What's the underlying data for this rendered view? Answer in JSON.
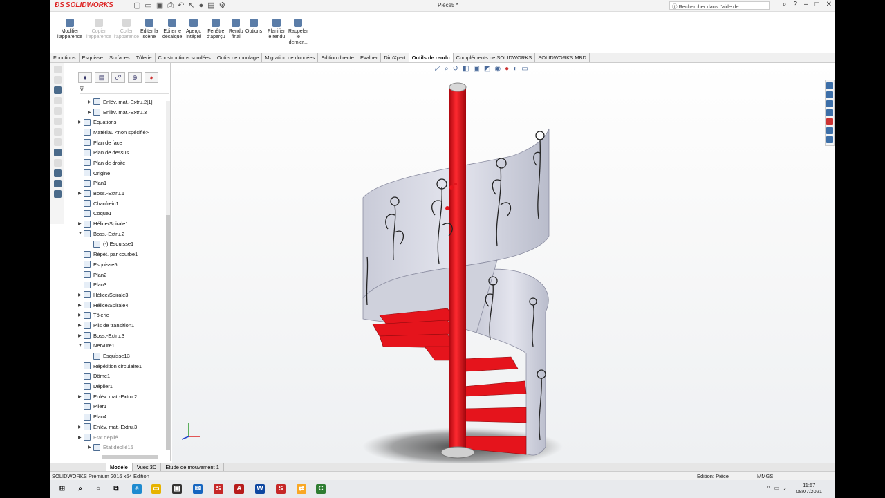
{
  "app": {
    "brand": "SOLIDWORKS",
    "document_title": "Pièce5 *",
    "search_placeholder": "Rechercher dans l'aide de SOLIDWORKS"
  },
  "ribbon": [
    {
      "label1": "Modifier",
      "label2": "l'apparence",
      "enabled": true
    },
    {
      "label1": "Copier",
      "label2": "l'apparence",
      "enabled": false
    },
    {
      "label1": "Coller",
      "label2": "l'apparence",
      "enabled": false
    },
    {
      "label1": "Editer la",
      "label2": "scène",
      "enabled": true
    },
    {
      "label1": "Editer le",
      "label2": "décalque",
      "enabled": true
    },
    {
      "label1": "Aperçu",
      "label2": "intégré",
      "enabled": true
    },
    {
      "label1": "Fenêtre",
      "label2": "d'aperçu",
      "enabled": true
    },
    {
      "label1": "Rendu",
      "label2": "final",
      "enabled": true
    },
    {
      "label1": "Options",
      "label2": "",
      "enabled": true
    },
    {
      "label1": "Planifier",
      "label2": "le rendu",
      "enabled": true
    },
    {
      "label1": "Rappeler",
      "label2": "le",
      "label3": "dernier...",
      "enabled": true
    }
  ],
  "tabs": [
    "Fonctions",
    "Esquisse",
    "Surfaces",
    "Tôlerie",
    "Constructions soudées",
    "Outils de moulage",
    "Migration de données",
    "Edition directe",
    "Evaluer",
    "DimXpert",
    "Outils de rendu",
    "Compléments de SOLIDWORKS",
    "SOLIDWORKS MBD"
  ],
  "active_tab": "Outils de rendu",
  "tree": [
    {
      "label": "Enlèv. mat.-Extru.2[1]",
      "indent": 1,
      "arrow": true
    },
    {
      "label": "Enlèv. mat.-Extru.3",
      "indent": 1,
      "arrow": true
    },
    {
      "label": "Equations",
      "indent": 0,
      "arrow": true
    },
    {
      "label": "Matériau <non spécifié>",
      "indent": 0,
      "arrow": false
    },
    {
      "label": "Plan de face",
      "indent": 0,
      "arrow": false
    },
    {
      "label": "Plan de dessus",
      "indent": 0,
      "arrow": false
    },
    {
      "label": "Plan de droite",
      "indent": 0,
      "arrow": false
    },
    {
      "label": "Origine",
      "indent": 0,
      "arrow": false
    },
    {
      "label": "Plan1",
      "indent": 0,
      "arrow": false
    },
    {
      "label": "Boss.-Extru.1",
      "indent": 0,
      "arrow": true
    },
    {
      "label": "Chanfrein1",
      "indent": 0,
      "arrow": false
    },
    {
      "label": "Coque1",
      "indent": 0,
      "arrow": false
    },
    {
      "label": "Hélice/Spirale1",
      "indent": 0,
      "arrow": true
    },
    {
      "label": "Boss.-Extru.2",
      "indent": 0,
      "arrow": true,
      "open": true
    },
    {
      "label": "(-) Esquisse1",
      "indent": 1,
      "arrow": false
    },
    {
      "label": "Répét. par courbe1",
      "indent": 0,
      "arrow": false
    },
    {
      "label": "Esquisse5",
      "indent": 0,
      "arrow": false
    },
    {
      "label": "Plan2",
      "indent": 0,
      "arrow": false
    },
    {
      "label": "Plan3",
      "indent": 0,
      "arrow": false
    },
    {
      "label": "Hélice/Spirale3",
      "indent": 0,
      "arrow": true
    },
    {
      "label": "Hélice/Spirale4",
      "indent": 0,
      "arrow": true
    },
    {
      "label": "Tôlerie",
      "indent": 0,
      "arrow": true
    },
    {
      "label": "Plis de transition1",
      "indent": 0,
      "arrow": true
    },
    {
      "label": "Boss.-Extru.3",
      "indent": 0,
      "arrow": true
    },
    {
      "label": "Nervure1",
      "indent": 0,
      "arrow": true,
      "open": true
    },
    {
      "label": "Esquisse13",
      "indent": 1,
      "arrow": false
    },
    {
      "label": "Répétition circulaire1",
      "indent": 0,
      "arrow": false
    },
    {
      "label": "Dôme1",
      "indent": 0,
      "arrow": false
    },
    {
      "label": "Déplier1",
      "indent": 0,
      "arrow": false
    },
    {
      "label": "Enlèv. mat.-Extru.2",
      "indent": 0,
      "arrow": true
    },
    {
      "label": "Plier1",
      "indent": 0,
      "arrow": false
    },
    {
      "label": "Plan4",
      "indent": 0,
      "arrow": false
    },
    {
      "label": "Enlèv. mat.-Extru.3",
      "indent": 0,
      "arrow": true
    },
    {
      "label": "Etat déplié",
      "indent": 0,
      "arrow": true,
      "greyed": true
    },
    {
      "label": "Etat déplié15",
      "indent": 1,
      "arrow": true,
      "greyed": true
    }
  ],
  "bottom_tabs": [
    "Modèle",
    "Vues 3D",
    "Etude de mouvement 1"
  ],
  "status": {
    "left": "SOLIDWORKS Premium 2016 x64 Edition",
    "mode": "Edition: Pièce",
    "units": "MMGS"
  },
  "taskbar": {
    "time": "11:57",
    "date": "08/07/2021"
  },
  "colors": {
    "stair_red": "#e5141c",
    "sheet_metal": "#d9dbe6"
  }
}
